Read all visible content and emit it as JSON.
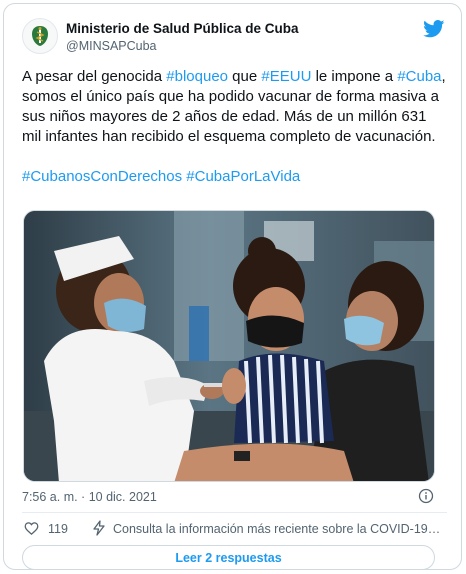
{
  "author": {
    "name": "Ministerio de Salud Pública de Cuba",
    "handle": "@MINSAPCuba"
  },
  "tweet": {
    "segments": [
      {
        "text": "A pesar del genocida ",
        "hashtag": false
      },
      {
        "text": "#bloqueo",
        "hashtag": true
      },
      {
        "text": " que ",
        "hashtag": false
      },
      {
        "text": "#EEUU",
        "hashtag": true
      },
      {
        "text": " le impone a ",
        "hashtag": false
      },
      {
        "text": "#Cuba",
        "hashtag": true
      },
      {
        "text": ", somos el único país que ha podido vacunar de forma masiva a sus niños mayores de 2 años de edad. Más de un millón 631 mil infantes han recibido el esquema completo de vacunación.",
        "hashtag": false
      }
    ],
    "hashtags": [
      "#CubanosConDerechos",
      "#CubaPorLaVida"
    ]
  },
  "image": {
    "description_icon": "photo-vaccination"
  },
  "meta": {
    "timestamp": "7:56 a. m. · 10 dic. 2021"
  },
  "actions": {
    "like_count": "119",
    "covid_notice": "Consulta la información más reciente sobre la COVID-19 en..."
  },
  "replies": {
    "label": "Leer 2 respuestas"
  },
  "colors": {
    "accent": "#1d9bf0",
    "text": "#0f1419",
    "secondary": "#536471",
    "border": "#cfd9de"
  }
}
